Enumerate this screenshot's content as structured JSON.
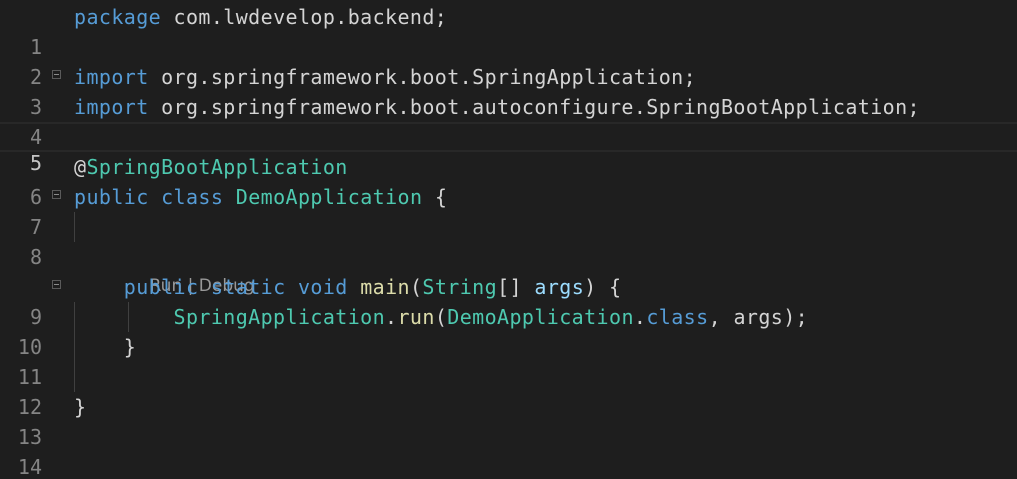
{
  "editor": {
    "line_numbers": [
      "1",
      "2",
      "3",
      "4",
      "5",
      "6",
      "7",
      "8",
      "9",
      "10",
      "11",
      "12",
      "13",
      "14"
    ],
    "codelens": {
      "run": "Run",
      "separator": " | ",
      "debug": "Debug"
    },
    "lines": [
      [
        {
          "t": "package",
          "c": "kw"
        },
        {
          "t": " com.lwdevelop.backend;",
          "c": "pl"
        }
      ],
      [],
      [
        {
          "t": "import",
          "c": "kw"
        },
        {
          "t": " org.springframework.boot.SpringApplication;",
          "c": "pl"
        }
      ],
      [
        {
          "t": "import",
          "c": "kw"
        },
        {
          "t": " org.springframework.boot.autoconfigure.SpringBootApplication;",
          "c": "pl"
        }
      ],
      [],
      [
        {
          "t": "@",
          "c": "pl"
        },
        {
          "t": "SpringBootApplication",
          "c": "ty"
        }
      ],
      [
        {
          "t": "public",
          "c": "kw"
        },
        {
          "t": " ",
          "c": "pl"
        },
        {
          "t": "class",
          "c": "kw"
        },
        {
          "t": " ",
          "c": "pl"
        },
        {
          "t": "DemoApplication",
          "c": "ty"
        },
        {
          "t": " {",
          "c": "pl"
        }
      ],
      [],
      [
        {
          "t": "    ",
          "c": "pl"
        },
        {
          "t": "public",
          "c": "kw"
        },
        {
          "t": " ",
          "c": "pl"
        },
        {
          "t": "static",
          "c": "kw"
        },
        {
          "t": " ",
          "c": "pl"
        },
        {
          "t": "void",
          "c": "kw"
        },
        {
          "t": " ",
          "c": "pl"
        },
        {
          "t": "main",
          "c": "fn"
        },
        {
          "t": "(",
          "c": "pl"
        },
        {
          "t": "String",
          "c": "ty"
        },
        {
          "t": "[] ",
          "c": "pl"
        },
        {
          "t": "args",
          "c": "va"
        },
        {
          "t": ") {",
          "c": "pl"
        }
      ],
      [
        {
          "t": "        ",
          "c": "pl"
        },
        {
          "t": "SpringApplication",
          "c": "ty"
        },
        {
          "t": ".",
          "c": "pl"
        },
        {
          "t": "run",
          "c": "fn"
        },
        {
          "t": "(",
          "c": "pl"
        },
        {
          "t": "DemoApplication",
          "c": "ty"
        },
        {
          "t": ".",
          "c": "pl"
        },
        {
          "t": "class",
          "c": "kw"
        },
        {
          "t": ", args);",
          "c": "pl"
        }
      ],
      [
        {
          "t": "    }",
          "c": "pl"
        }
      ],
      [],
      [
        {
          "t": "}",
          "c": "pl"
        }
      ],
      []
    ]
  }
}
